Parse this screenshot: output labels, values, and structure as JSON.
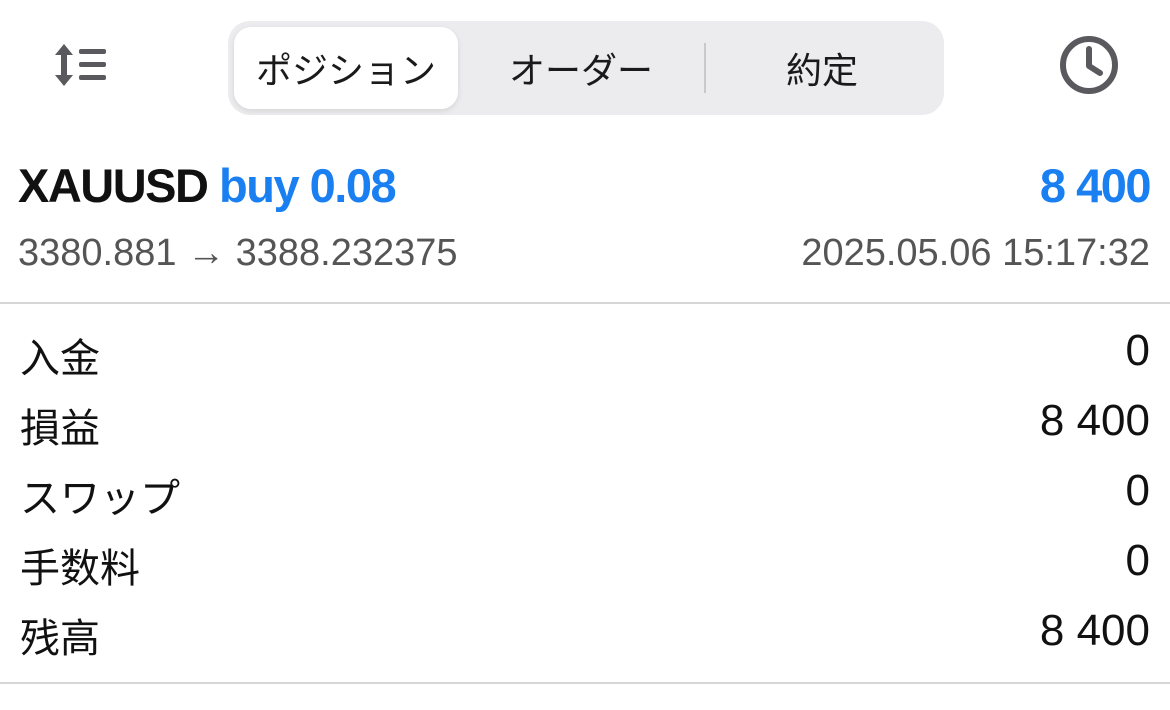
{
  "toolbar": {
    "sort_icon": "sort-icon",
    "history_icon": "clock-icon"
  },
  "tabs": [
    {
      "label": "ポジション",
      "active": true
    },
    {
      "label": "オーダー",
      "active": false
    },
    {
      "label": "約定",
      "active": false
    }
  ],
  "position": {
    "symbol": "XAUUSD",
    "side": "buy",
    "volume": "0.08",
    "profit": "8 400",
    "open_price": "3380.881",
    "arrow": "→",
    "current_price": "3388.232375",
    "time": "2025.05.06 15:17:32"
  },
  "summary": [
    {
      "label": "入金",
      "value": "0"
    },
    {
      "label": "損益",
      "value": "8 400"
    },
    {
      "label": "スワップ",
      "value": "0"
    },
    {
      "label": "手数料",
      "value": "0"
    },
    {
      "label": "残高",
      "value": "8 400"
    }
  ],
  "colors": {
    "accent": "#1a7ff0",
    "icon": "#5a5a5e",
    "secondary_text": "#555555",
    "segment_bg": "#ececee"
  }
}
